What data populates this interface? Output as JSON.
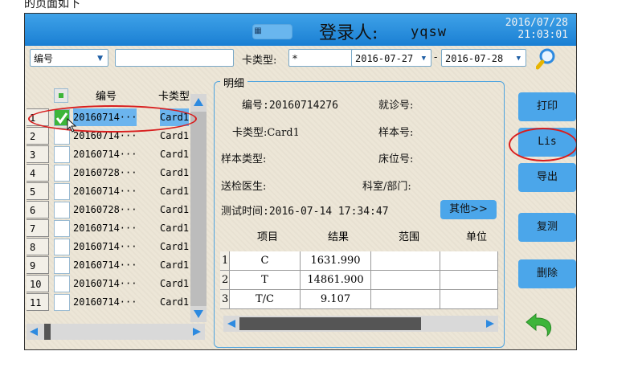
{
  "caption": "的页面如下",
  "header": {
    "login_label": "登录人:",
    "user": "yqsw",
    "date": "2016/07/28",
    "time": "21:03:01"
  },
  "filters": {
    "field_select": "编号",
    "field_value": "",
    "card_type_label": "卡类型:",
    "card_type_value": "*",
    "date_separator": "-",
    "date_from": "2016-07-27",
    "date_to": "2016-07-28"
  },
  "list": {
    "col_code": "编号",
    "col_type": "卡类型",
    "rows": [
      {
        "num": "1",
        "code": "20160714···",
        "type": "Card1",
        "checked": true
      },
      {
        "num": "2",
        "code": "20160714···",
        "type": "Card1",
        "checked": false
      },
      {
        "num": "3",
        "code": "20160714···",
        "type": "Card1",
        "checked": false
      },
      {
        "num": "4",
        "code": "20160728···",
        "type": "Card1",
        "checked": false
      },
      {
        "num": "5",
        "code": "20160714···",
        "type": "Card1",
        "checked": false
      },
      {
        "num": "6",
        "code": "20160728···",
        "type": "Card1",
        "checked": false
      },
      {
        "num": "7",
        "code": "20160714···",
        "type": "Card1",
        "checked": false
      },
      {
        "num": "8",
        "code": "20160714···",
        "type": "Card1",
        "checked": false
      },
      {
        "num": "9",
        "code": "20160714···",
        "type": "Card1",
        "checked": false
      },
      {
        "num": "10",
        "code": "20160714···",
        "type": "Card1",
        "checked": false
      },
      {
        "num": "11",
        "code": "20160714···",
        "type": "Card1",
        "checked": false
      }
    ]
  },
  "detail": {
    "title": "明细",
    "code": "编号:20160714276",
    "visit_no": "就诊号:",
    "card_type": "卡类型:Card1",
    "sample_no": "样本号:",
    "sample_type": "样本类型:",
    "bed_no": "床位号:",
    "doctor": "送检医生:",
    "department": "科室/部门:",
    "test_time": "测试时间:2016-07-14 17:34:47",
    "other_button": "其他>>"
  },
  "results": {
    "headers": [
      "项目",
      "结果",
      "范围",
      "单位"
    ],
    "rows": [
      {
        "num": "1",
        "item": "C",
        "value": "1631.990",
        "range": "",
        "unit": ""
      },
      {
        "num": "2",
        "item": "T",
        "value": "14861.900",
        "range": "",
        "unit": ""
      },
      {
        "num": "3",
        "item": "T/C",
        "value": "9.107",
        "range": "",
        "unit": ""
      }
    ]
  },
  "actions": {
    "print": "打印",
    "lis": "Lis",
    "export": "导出",
    "retest": "复测",
    "delete": "删除"
  },
  "colors": {
    "title_bar": "#2a8fdc",
    "button": "#4ba6ea",
    "selection": "#6bb4ee",
    "annotation": "#d81e1e",
    "back_arrow": "#3db53a"
  }
}
